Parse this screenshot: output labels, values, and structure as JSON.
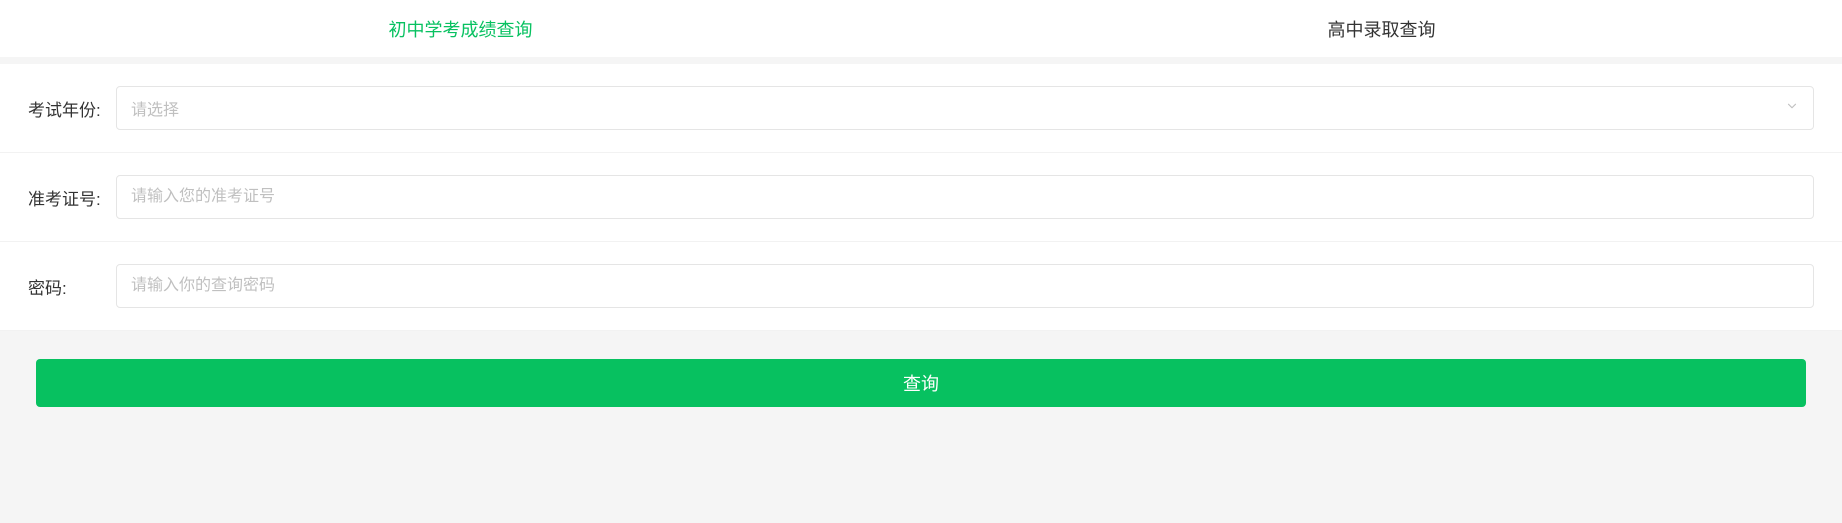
{
  "tabs": {
    "score": "初中学考成绩查询",
    "admission": "高中录取查询"
  },
  "form": {
    "year": {
      "label": "考试年份:",
      "placeholder": "请选择"
    },
    "ticket": {
      "label": "准考证号:",
      "placeholder": "请输入您的准考证号"
    },
    "password": {
      "label": "密码:",
      "placeholder": "请输入你的查询密码"
    }
  },
  "submit_label": "查询"
}
